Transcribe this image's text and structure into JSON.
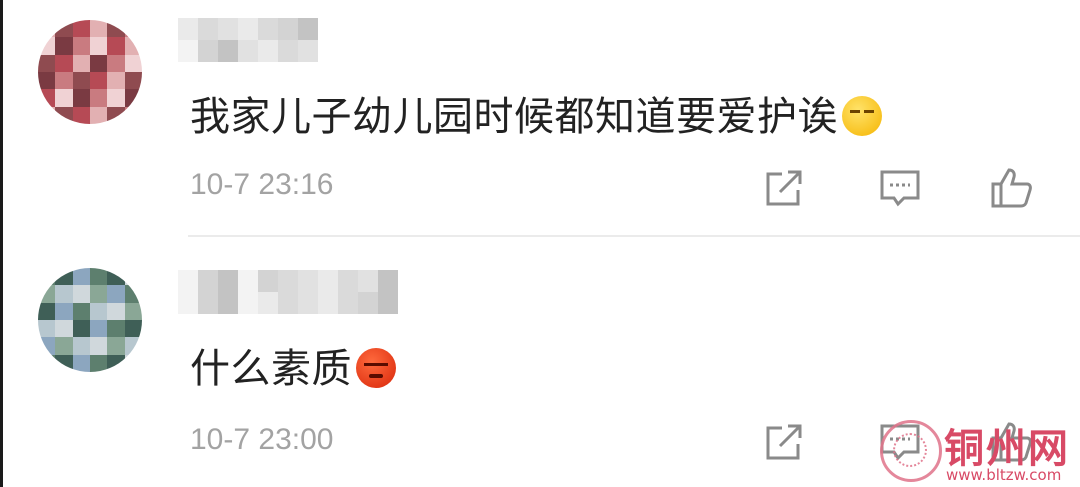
{
  "comments": [
    {
      "username": "",
      "text": "我家儿子幼儿园时候都知道要爱护诶",
      "emoji": "smirk-emoji",
      "time": "10-7 23:16",
      "avatar_palette": [
        "#7a3a42",
        "#b64a55",
        "#c97b80",
        "#e2b0b2",
        "#f0d2d4",
        "#8f4b50"
      ]
    },
    {
      "username": "",
      "text": "什么素质",
      "emoji": "angry-emoji",
      "time": "10-7 23:00",
      "avatar_palette": [
        "#5d7f6e",
        "#8aa796",
        "#3f5f57",
        "#b7c7cf",
        "#8ca6bf",
        "#d0d8dc"
      ]
    }
  ],
  "actions": {
    "share_icon": "share-icon",
    "reply_icon": "reply-icon",
    "like_icon": "like-icon",
    "icon_color": "#8a8a8a"
  },
  "watermark": {
    "title": "铜州网",
    "url": "www.bltzw.com",
    "color": "#d84a66"
  }
}
